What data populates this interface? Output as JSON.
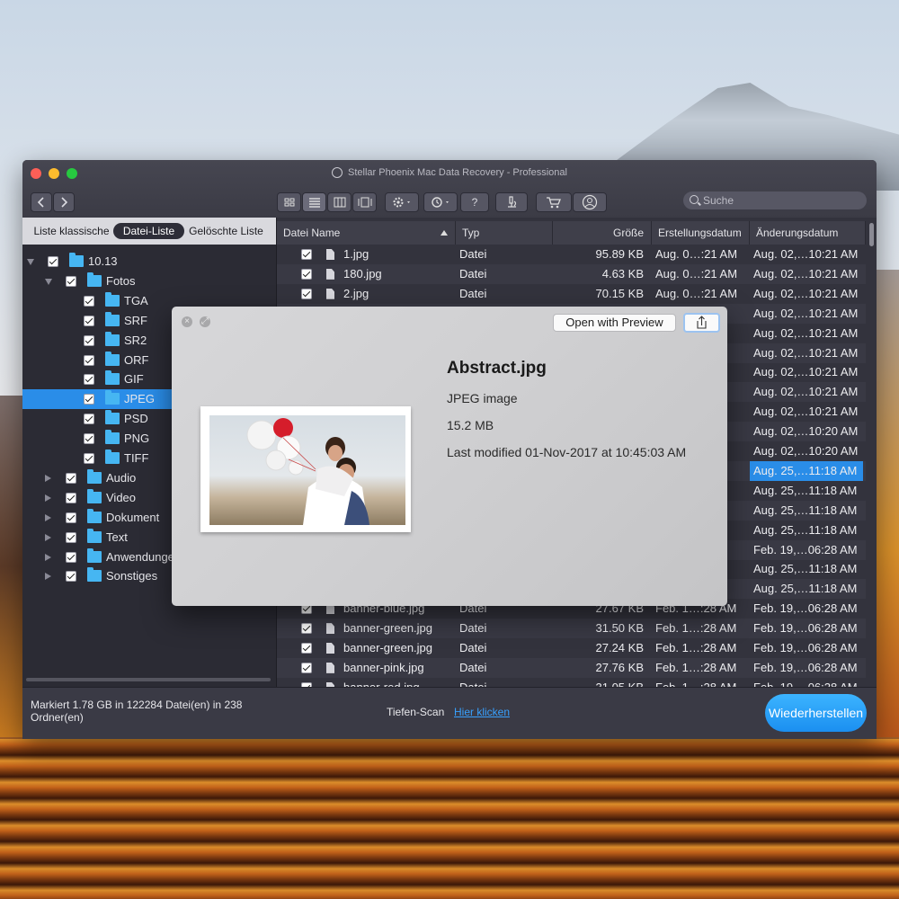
{
  "window": {
    "title": "Stellar Phoenix Mac Data Recovery - Professional"
  },
  "toolbar": {
    "help_label": "?",
    "search_placeholder": "Suche"
  },
  "tabs": [
    "Liste klassische",
    "Datei-Liste",
    "Gelöschte Liste"
  ],
  "active_tab": "Datei-Liste",
  "tree": [
    {
      "label": "10.13",
      "level": 0,
      "expander": "down"
    },
    {
      "label": "Fotos",
      "level": 1,
      "expander": "down"
    },
    {
      "label": "TGA",
      "level": 2,
      "expander": "none"
    },
    {
      "label": "SRF",
      "level": 2,
      "expander": "none"
    },
    {
      "label": "SR2",
      "level": 2,
      "expander": "none"
    },
    {
      "label": "ORF",
      "level": 2,
      "expander": "none"
    },
    {
      "label": "GIF",
      "level": 2,
      "expander": "none"
    },
    {
      "label": "JPEG",
      "level": 2,
      "expander": "none",
      "selected": true
    },
    {
      "label": "PSD",
      "level": 2,
      "expander": "none"
    },
    {
      "label": "PNG",
      "level": 2,
      "expander": "none"
    },
    {
      "label": "TIFF",
      "level": 2,
      "expander": "none"
    },
    {
      "label": "Audio",
      "level": 1,
      "expander": "right"
    },
    {
      "label": "Video",
      "level": 1,
      "expander": "right"
    },
    {
      "label": "Dokument",
      "level": 1,
      "expander": "right"
    },
    {
      "label": "Text",
      "level": 1,
      "expander": "right"
    },
    {
      "label": "Anwendungen",
      "level": 1,
      "expander": "right"
    },
    {
      "label": "Sonstiges",
      "level": 1,
      "expander": "right"
    }
  ],
  "table": {
    "headers": [
      "Datei Name",
      "Typ",
      "Größe",
      "Erstellungsdatum",
      "Änderungsdatum"
    ],
    "rows": [
      {
        "name": "1.jpg",
        "type": "Datei",
        "size": "95.89 KB",
        "created": "Aug. 0…:21 AM",
        "modified": "Aug. 02,…10:21 AM"
      },
      {
        "name": "180.jpg",
        "type": "Datei",
        "size": "4.63 KB",
        "created": "Aug. 0…:21 AM",
        "modified": "Aug. 02,…10:21 AM"
      },
      {
        "name": "2.jpg",
        "type": "Datei",
        "size": "70.15 KB",
        "created": "Aug. 0…:21 AM",
        "modified": "Aug. 02,…10:21 AM"
      },
      {
        "name": "",
        "type": "",
        "size": "",
        "created": "",
        "modified": "Aug. 02,…10:21 AM"
      },
      {
        "name": "",
        "type": "",
        "size": "",
        "created": "",
        "modified": "Aug. 02,…10:21 AM"
      },
      {
        "name": "",
        "type": "",
        "size": "",
        "created": "",
        "modified": "Aug. 02,…10:21 AM"
      },
      {
        "name": "",
        "type": "",
        "size": "",
        "created": "",
        "modified": "Aug. 02,…10:21 AM"
      },
      {
        "name": "",
        "type": "",
        "size": "",
        "created": "",
        "modified": "Aug. 02,…10:21 AM"
      },
      {
        "name": "",
        "type": "",
        "size": "",
        "created": "",
        "modified": "Aug. 02,…10:21 AM"
      },
      {
        "name": "",
        "type": "",
        "size": "",
        "created": "",
        "modified": "Aug. 02,…10:20 AM"
      },
      {
        "name": "",
        "type": "",
        "size": "",
        "created": "",
        "modified": "Aug. 02,…10:20 AM"
      },
      {
        "name": "",
        "type": "",
        "size": "",
        "created": "",
        "modified": "Aug. 25,…11:18 AM",
        "selected": true
      },
      {
        "name": "",
        "type": "",
        "size": "",
        "created": "",
        "modified": "Aug. 25,…11:18 AM"
      },
      {
        "name": "",
        "type": "",
        "size": "",
        "created": "",
        "modified": "Aug. 25,…11:18 AM"
      },
      {
        "name": "",
        "type": "",
        "size": "",
        "created": "",
        "modified": "Aug. 25,…11:18 AM"
      },
      {
        "name": "",
        "type": "",
        "size": "",
        "created": "",
        "modified": "Feb. 19,…06:28 AM"
      },
      {
        "name": "",
        "type": "",
        "size": "",
        "created": "",
        "modified": "Aug. 25,…11:18 AM"
      },
      {
        "name": "",
        "type": "",
        "size": "",
        "created": "",
        "modified": "Aug. 25,…11:18 AM"
      },
      {
        "name": "banner-blue.jpg",
        "type": "Datei",
        "size": "27.67 KB",
        "created": "Feb. 1…:28 AM",
        "modified": "Feb. 19,…06:28 AM"
      },
      {
        "name": "banner-green.jpg",
        "type": "Datei",
        "size": "31.50 KB",
        "created": "Feb. 1…:28 AM",
        "modified": "Feb. 19,…06:28 AM"
      },
      {
        "name": "banner-green.jpg",
        "type": "Datei",
        "size": "27.24 KB",
        "created": "Feb. 1…:28 AM",
        "modified": "Feb. 19,…06:28 AM"
      },
      {
        "name": "banner-pink.jpg",
        "type": "Datei",
        "size": "27.76 KB",
        "created": "Feb. 1…:28 AM",
        "modified": "Feb. 19,…06:28 AM"
      },
      {
        "name": "banner-red.jpg",
        "type": "Datei",
        "size": "31.05 KB",
        "created": "Feb. 1…:28 AM",
        "modified": "Feb. 19,…06:28 AM"
      }
    ]
  },
  "status": {
    "marked": "Markiert 1.78 GB in 122284 Datei(en) in 238 Ordner(en)",
    "deep_scan_label": "Tiefen-Scan",
    "deep_scan_link": "Hier klicken",
    "restore_button": "Wiederherstellen"
  },
  "quicklook": {
    "open_button": "Open with Preview",
    "file_name": "Abstract.jpg",
    "kind": "JPEG image",
    "size": "15.2 MB",
    "modified": "Last modified 01-Nov-2017 at 10:45:03 AM"
  }
}
